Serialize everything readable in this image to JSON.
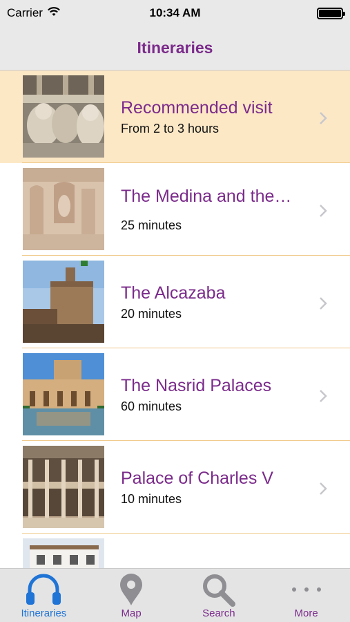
{
  "status_bar": {
    "carrier": "Carrier",
    "time": "10:34 AM",
    "battery_level": 1.0
  },
  "nav": {
    "title": "Itineraries"
  },
  "itineraries": [
    {
      "title": "Recommended visit",
      "subtitle": "From 2 to 3 hours",
      "highlighted": true,
      "icon": "lions-fountain"
    },
    {
      "title": "The Medina and the…",
      "subtitle": "25 minutes",
      "highlighted": false,
      "icon": "carved-wall"
    },
    {
      "title": "The Alcazaba",
      "subtitle": "20 minutes",
      "highlighted": false,
      "icon": "tower"
    },
    {
      "title": "The Nasrid Palaces",
      "subtitle": "60 minutes",
      "highlighted": false,
      "icon": "palace-pool"
    },
    {
      "title": "Palace of Charles V",
      "subtitle": "10 minutes",
      "highlighted": false,
      "icon": "colonnade"
    },
    {
      "title": "",
      "subtitle": "",
      "highlighted": false,
      "icon": "white-building"
    }
  ],
  "tabs": [
    {
      "label": "Itineraries",
      "icon": "headphones-icon",
      "active": true
    },
    {
      "label": "Map",
      "icon": "map-pin-icon",
      "active": false
    },
    {
      "label": "Search",
      "icon": "search-icon",
      "active": false
    },
    {
      "label": "More",
      "icon": "more-icon",
      "active": false
    }
  ],
  "colors": {
    "accent": "#7b2b8b",
    "active_tab": "#1f74d6",
    "highlight_row": "#fde8c6",
    "separator": "#f0c98a"
  }
}
